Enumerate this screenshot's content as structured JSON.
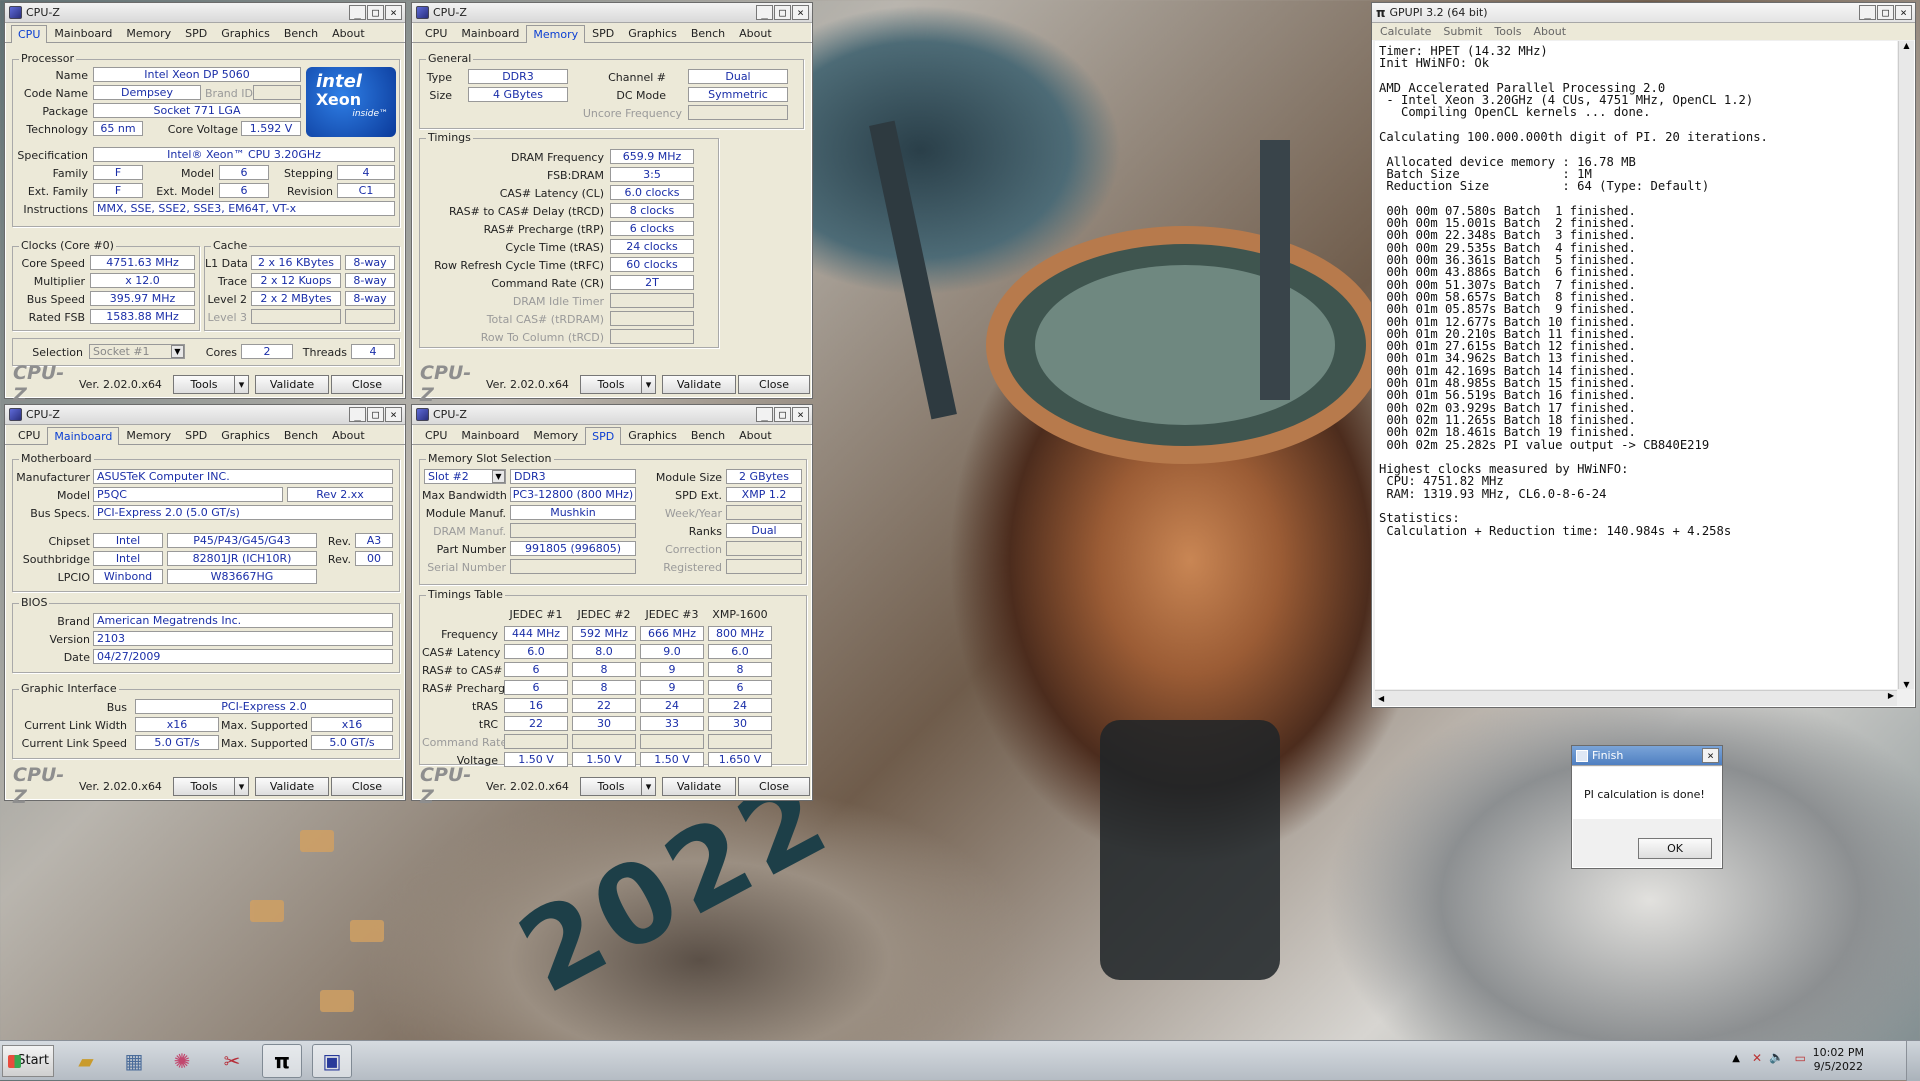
{
  "cpu_window": {
    "title": "CPU-Z",
    "tabs": [
      "CPU",
      "Mainboard",
      "Memory",
      "SPD",
      "Graphics",
      "Bench",
      "About"
    ],
    "processor_group": "Processor",
    "name_label": "Name",
    "name": "Intel Xeon DP 5060",
    "codename_label": "Code Name",
    "codename": "Dempsey",
    "brandid_label": "Brand ID",
    "package_label": "Package",
    "package": "Socket 771 LGA",
    "technology_label": "Technology",
    "technology": "65 nm",
    "corevoltage_label": "Core Voltage",
    "corevoltage": "1.592 V",
    "spec_label": "Specification",
    "spec": "Intel® Xeon™ CPU 3.20GHz",
    "family_label": "Family",
    "family": "F",
    "model_label": "Model",
    "model": "6",
    "stepping_label": "Stepping",
    "stepping": "4",
    "extfamily_label": "Ext. Family",
    "extfamily": "F",
    "extmodel_label": "Ext. Model",
    "extmodel": "6",
    "revision_label": "Revision",
    "revision": "C1",
    "instructions_label": "Instructions",
    "instructions": "MMX, SSE, SSE2, SSE3, EM64T, VT-x",
    "logo_intel": "intel",
    "logo_xeon": "Xeon",
    "logo_inside": "inside™",
    "clocks_group": "Clocks (Core #0)",
    "corespeed_label": "Core Speed",
    "corespeed": "4751.63 MHz",
    "multiplier_label": "Multiplier",
    "multiplier": "x 12.0",
    "busspeed_label": "Bus Speed",
    "busspeed": "395.97 MHz",
    "ratedfsb_label": "Rated FSB",
    "ratedfsb": "1583.88 MHz",
    "cache_group": "Cache",
    "l1data_label": "L1 Data",
    "l1data": "2 x 16 KBytes",
    "l1data_way": "8-way",
    "trace_label": "Trace",
    "trace": "2 x 12 Kuops",
    "trace_way": "8-way",
    "level2_label": "Level 2",
    "level2": "2 x 2 MBytes",
    "level2_way": "8-way",
    "level3_label": "Level 3",
    "selection_label": "Selection",
    "selection": "Socket #1",
    "cores_label": "Cores",
    "cores": "2",
    "threads_label": "Threads",
    "threads": "4"
  },
  "footer": {
    "brand": "CPU-Z",
    "version": "Ver. 2.02.0.x64",
    "tools": "Tools",
    "validate": "Validate",
    "close": "Close"
  },
  "memory_window": {
    "title": "CPU-Z",
    "general_group": "General",
    "type_label": "Type",
    "type": "DDR3",
    "channel_label": "Channel #",
    "channel": "Dual",
    "size_label": "Size",
    "size": "4 GBytes",
    "dcmode_label": "DC Mode",
    "dcmode": "Symmetric",
    "uncore_label": "Uncore Frequency",
    "timings_group": "Timings",
    "dram_freq_label": "DRAM Frequency",
    "dram_freq": "659.9 MHz",
    "fsbdram_label": "FSB:DRAM",
    "fsbdram": "3:5",
    "cl_label": "CAS# Latency (CL)",
    "cl": "6.0 clocks",
    "trcd_label": "RAS# to CAS# Delay (tRCD)",
    "trcd": "8 clocks",
    "trp_label": "RAS# Precharge (tRP)",
    "trp": "6 clocks",
    "tras_label": "Cycle Time (tRAS)",
    "tras": "24 clocks",
    "trfc_label": "Row Refresh Cycle Time (tRFC)",
    "trfc": "60 clocks",
    "cr_label": "Command Rate (CR)",
    "cr": "2T",
    "idle_label": "DRAM Idle Timer",
    "totalcas_label": "Total CAS# (tRDRAM)",
    "rowcol_label": "Row To Column (tRCD)"
  },
  "mainboard_window": {
    "title": "CPU-Z",
    "motherboard_group": "Motherboard",
    "manufacturer_label": "Manufacturer",
    "manufacturer": "ASUSTeK Computer INC.",
    "model_label": "Model",
    "model": "P5QC",
    "model_rev": "Rev 2.xx",
    "busspecs_label": "Bus Specs.",
    "busspecs": "PCI-Express 2.0 (5.0 GT/s)",
    "chipset_label": "Chipset",
    "chipset_vendor": "Intel",
    "chipset": "P45/P43/G45/G43",
    "chipset_rev_label": "Rev.",
    "chipset_rev": "A3",
    "southbridge_label": "Southbridge",
    "sb_vendor": "Intel",
    "southbridge": "82801JR (ICH10R)",
    "sb_rev_label": "Rev.",
    "sb_rev": "00",
    "lpcio_label": "LPCIO",
    "lpcio_vendor": "Winbond",
    "lpcio": "W83667HG",
    "bios_group": "BIOS",
    "brand_label": "Brand",
    "brand": "American Megatrends Inc.",
    "version_label": "Version",
    "version": "2103",
    "date_label": "Date",
    "date": "04/27/2009",
    "gi_group": "Graphic Interface",
    "bus_label": "Bus",
    "bus": "PCI-Express 2.0",
    "linkwidth_label": "Current Link Width",
    "linkwidth": "x16",
    "maxsup_label": "Max. Supported",
    "maxwidth": "x16",
    "linkspeed_label": "Current Link Speed",
    "linkspeed": "5.0 GT/s",
    "maxspeed": "5.0 GT/s"
  },
  "spd_window": {
    "title": "CPU-Z",
    "slot_group": "Memory Slot Selection",
    "slot": "Slot #2",
    "slot_type": "DDR3",
    "modsize_label": "Module Size",
    "modsize": "2 GBytes",
    "maxbw_label": "Max Bandwidth",
    "maxbw": "PC3-12800 (800 MHz)",
    "spdext_label": "SPD Ext.",
    "spdext": "XMP 1.2",
    "modmanuf_label": "Module Manuf.",
    "modmanuf": "Mushkin",
    "weekyear_label": "Week/Year",
    "drammanuf_label": "DRAM Manuf.",
    "ranks_label": "Ranks",
    "ranks": "Dual",
    "partnum_label": "Part Number",
    "partnum": "991805 (996805)",
    "correction_label": "Correction",
    "serial_label": "Serial Number",
    "registered_label": "Registered",
    "tt_group": "Timings Table",
    "columns": [
      "JEDEC #1",
      "JEDEC #2",
      "JEDEC #3",
      "XMP-1600"
    ],
    "rows": [
      {
        "label": "Frequency",
        "values": [
          "444 MHz",
          "592 MHz",
          "666 MHz",
          "800 MHz"
        ]
      },
      {
        "label": "CAS# Latency",
        "values": [
          "6.0",
          "8.0",
          "9.0",
          "6.0"
        ]
      },
      {
        "label": "RAS# to CAS#",
        "values": [
          "6",
          "8",
          "9",
          "8"
        ]
      },
      {
        "label": "RAS# Precharge",
        "values": [
          "6",
          "8",
          "9",
          "6"
        ]
      },
      {
        "label": "tRAS",
        "values": [
          "16",
          "22",
          "24",
          "24"
        ]
      },
      {
        "label": "tRC",
        "values": [
          "22",
          "30",
          "33",
          "30"
        ]
      },
      {
        "label": "Command Rate",
        "values": [
          "",
          "",
          "",
          ""
        ]
      },
      {
        "label": "Voltage",
        "values": [
          "1.50 V",
          "1.50 V",
          "1.50 V",
          "1.650 V"
        ]
      }
    ]
  },
  "gpupi": {
    "title": "GPUPI 3.2 (64 bit)",
    "menu": [
      "Calculate",
      "Submit",
      "Tools",
      "About"
    ],
    "console": "Timer: HPET (14.32 MHz)\nInit HWiNFO: Ok\n\nAMD Accelerated Parallel Processing 2.0\n - Intel Xeon 3.20GHz (4 CUs, 4751 MHz, OpenCL 1.2)\n   Compiling OpenCL kernels ... done.\n\nCalculating 100.000.000th digit of PI. 20 iterations.\n\n Allocated device memory : 16.78 MB\n Batch Size              : 1M\n Reduction Size          : 64 (Type: Default)\n\n 00h 00m 07.580s Batch  1 finished.\n 00h 00m 15.001s Batch  2 finished.\n 00h 00m 22.348s Batch  3 finished.\n 00h 00m 29.535s Batch  4 finished.\n 00h 00m 36.361s Batch  5 finished.\n 00h 00m 43.886s Batch  6 finished.\n 00h 00m 51.307s Batch  7 finished.\n 00h 00m 58.657s Batch  8 finished.\n 00h 01m 05.857s Batch  9 finished.\n 00h 01m 12.677s Batch 10 finished.\n 00h 01m 20.210s Batch 11 finished.\n 00h 01m 27.615s Batch 12 finished.\n 00h 01m 34.962s Batch 13 finished.\n 00h 01m 42.169s Batch 14 finished.\n 00h 01m 48.985s Batch 15 finished.\n 00h 01m 56.519s Batch 16 finished.\n 00h 02m 03.929s Batch 17 finished.\n 00h 02m 11.265s Batch 18 finished.\n 00h 02m 18.461s Batch 19 finished.\n 00h 02m 25.282s PI value output -> CB840E219\n\nHighest clocks measured by HWiNFO:\n CPU: 4751.82 MHz\n RAM: 1319.93 MHz, CL6.0-8-6-24\n\nStatistics:\n Calculation + Reduction time: 140.984s + 4.258s"
  },
  "finish": {
    "title": "Finish",
    "message": "PI calculation is done!",
    "ok": "OK"
  },
  "taskbar": {
    "start": "Start",
    "time": "10:02 PM",
    "date": "9/5/2022",
    "wallpaper_text": "2022"
  }
}
